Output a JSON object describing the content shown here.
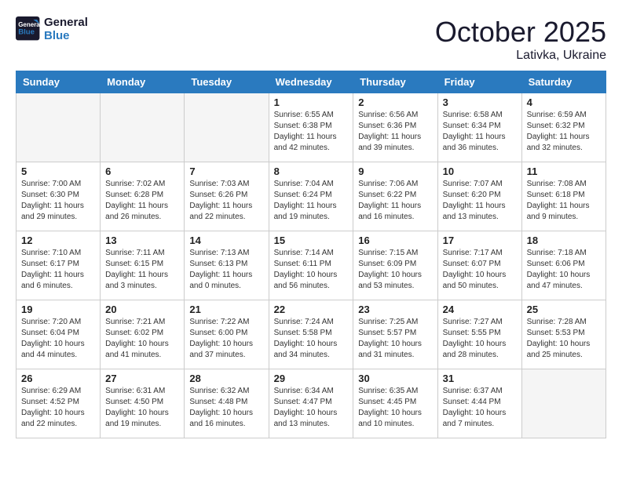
{
  "header": {
    "logo_line1": "General",
    "logo_line2": "Blue",
    "month": "October 2025",
    "location": "Lativka, Ukraine"
  },
  "days_of_week": [
    "Sunday",
    "Monday",
    "Tuesday",
    "Wednesday",
    "Thursday",
    "Friday",
    "Saturday"
  ],
  "weeks": [
    [
      {
        "day": "",
        "info": ""
      },
      {
        "day": "",
        "info": ""
      },
      {
        "day": "",
        "info": ""
      },
      {
        "day": "1",
        "info": "Sunrise: 6:55 AM\nSunset: 6:38 PM\nDaylight: 11 hours and 42 minutes."
      },
      {
        "day": "2",
        "info": "Sunrise: 6:56 AM\nSunset: 6:36 PM\nDaylight: 11 hours and 39 minutes."
      },
      {
        "day": "3",
        "info": "Sunrise: 6:58 AM\nSunset: 6:34 PM\nDaylight: 11 hours and 36 minutes."
      },
      {
        "day": "4",
        "info": "Sunrise: 6:59 AM\nSunset: 6:32 PM\nDaylight: 11 hours and 32 minutes."
      }
    ],
    [
      {
        "day": "5",
        "info": "Sunrise: 7:00 AM\nSunset: 6:30 PM\nDaylight: 11 hours and 29 minutes."
      },
      {
        "day": "6",
        "info": "Sunrise: 7:02 AM\nSunset: 6:28 PM\nDaylight: 11 hours and 26 minutes."
      },
      {
        "day": "7",
        "info": "Sunrise: 7:03 AM\nSunset: 6:26 PM\nDaylight: 11 hours and 22 minutes."
      },
      {
        "day": "8",
        "info": "Sunrise: 7:04 AM\nSunset: 6:24 PM\nDaylight: 11 hours and 19 minutes."
      },
      {
        "day": "9",
        "info": "Sunrise: 7:06 AM\nSunset: 6:22 PM\nDaylight: 11 hours and 16 minutes."
      },
      {
        "day": "10",
        "info": "Sunrise: 7:07 AM\nSunset: 6:20 PM\nDaylight: 11 hours and 13 minutes."
      },
      {
        "day": "11",
        "info": "Sunrise: 7:08 AM\nSunset: 6:18 PM\nDaylight: 11 hours and 9 minutes."
      }
    ],
    [
      {
        "day": "12",
        "info": "Sunrise: 7:10 AM\nSunset: 6:17 PM\nDaylight: 11 hours and 6 minutes."
      },
      {
        "day": "13",
        "info": "Sunrise: 7:11 AM\nSunset: 6:15 PM\nDaylight: 11 hours and 3 minutes."
      },
      {
        "day": "14",
        "info": "Sunrise: 7:13 AM\nSunset: 6:13 PM\nDaylight: 11 hours and 0 minutes."
      },
      {
        "day": "15",
        "info": "Sunrise: 7:14 AM\nSunset: 6:11 PM\nDaylight: 10 hours and 56 minutes."
      },
      {
        "day": "16",
        "info": "Sunrise: 7:15 AM\nSunset: 6:09 PM\nDaylight: 10 hours and 53 minutes."
      },
      {
        "day": "17",
        "info": "Sunrise: 7:17 AM\nSunset: 6:07 PM\nDaylight: 10 hours and 50 minutes."
      },
      {
        "day": "18",
        "info": "Sunrise: 7:18 AM\nSunset: 6:06 PM\nDaylight: 10 hours and 47 minutes."
      }
    ],
    [
      {
        "day": "19",
        "info": "Sunrise: 7:20 AM\nSunset: 6:04 PM\nDaylight: 10 hours and 44 minutes."
      },
      {
        "day": "20",
        "info": "Sunrise: 7:21 AM\nSunset: 6:02 PM\nDaylight: 10 hours and 41 minutes."
      },
      {
        "day": "21",
        "info": "Sunrise: 7:22 AM\nSunset: 6:00 PM\nDaylight: 10 hours and 37 minutes."
      },
      {
        "day": "22",
        "info": "Sunrise: 7:24 AM\nSunset: 5:58 PM\nDaylight: 10 hours and 34 minutes."
      },
      {
        "day": "23",
        "info": "Sunrise: 7:25 AM\nSunset: 5:57 PM\nDaylight: 10 hours and 31 minutes."
      },
      {
        "day": "24",
        "info": "Sunrise: 7:27 AM\nSunset: 5:55 PM\nDaylight: 10 hours and 28 minutes."
      },
      {
        "day": "25",
        "info": "Sunrise: 7:28 AM\nSunset: 5:53 PM\nDaylight: 10 hours and 25 minutes."
      }
    ],
    [
      {
        "day": "26",
        "info": "Sunrise: 6:29 AM\nSunset: 4:52 PM\nDaylight: 10 hours and 22 minutes."
      },
      {
        "day": "27",
        "info": "Sunrise: 6:31 AM\nSunset: 4:50 PM\nDaylight: 10 hours and 19 minutes."
      },
      {
        "day": "28",
        "info": "Sunrise: 6:32 AM\nSunset: 4:48 PM\nDaylight: 10 hours and 16 minutes."
      },
      {
        "day": "29",
        "info": "Sunrise: 6:34 AM\nSunset: 4:47 PM\nDaylight: 10 hours and 13 minutes."
      },
      {
        "day": "30",
        "info": "Sunrise: 6:35 AM\nSunset: 4:45 PM\nDaylight: 10 hours and 10 minutes."
      },
      {
        "day": "31",
        "info": "Sunrise: 6:37 AM\nSunset: 4:44 PM\nDaylight: 10 hours and 7 minutes."
      },
      {
        "day": "",
        "info": ""
      }
    ]
  ]
}
